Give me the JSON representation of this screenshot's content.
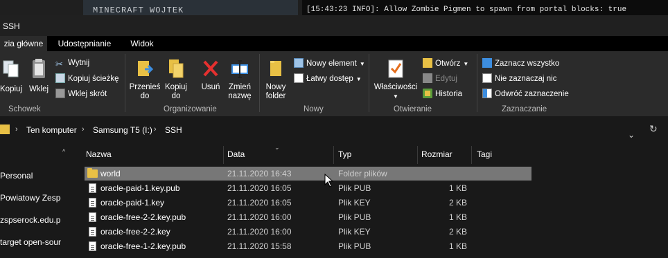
{
  "background": {
    "left_window_title": "MINECRAFT WOJTEK",
    "console_line": "[15:43:23 INFO]: Allow Zombie Pigmen to spawn from portal blocks: true"
  },
  "window": {
    "title": "SSH"
  },
  "ribbon_tabs": [
    {
      "label": "zia główne",
      "active": true
    },
    {
      "label": "Udostępnianie",
      "active": false
    },
    {
      "label": "Widok",
      "active": false
    }
  ],
  "ribbon": {
    "clipboard": {
      "copy": "Kopiuj",
      "paste": "Wklej",
      "cut": "Wytnij",
      "copy_path": "Kopiuj ścieżkę",
      "paste_shortcut": "Wklej skrót",
      "group": "Schowek"
    },
    "organize": {
      "move_to_1": "Przenieś",
      "move_to_2": "do",
      "copy_to_1": "Kopiuj",
      "copy_to_2": "do",
      "delete": "Usuń",
      "rename_1": "Zmień",
      "rename_2": "nazwę",
      "group": "Organizowanie"
    },
    "new": {
      "new_folder_1": "Nowy",
      "new_folder_2": "folder",
      "new_item": "Nowy element",
      "easy_access": "Łatwy dostęp",
      "group": "Nowy"
    },
    "open": {
      "properties": "Właściwości",
      "open": "Otwórz",
      "edit": "Edytuj",
      "history": "Historia",
      "group": "Otwieranie"
    },
    "select": {
      "select_all": "Zaznacz wszystko",
      "select_none": "Nie zaznaczaj nic",
      "invert": "Odwróć zaznaczenie",
      "group": "Zaznaczanie"
    }
  },
  "address": {
    "crumbs": [
      "Ten komputer",
      "Samsung T5 (I:)",
      "SSH"
    ]
  },
  "nav": {
    "items": [
      "Personal",
      "Powiatowy Zespo",
      "zspserock.edu.p",
      "target open-sour"
    ]
  },
  "columns": [
    "Nazwa",
    "Data",
    "Typ",
    "Rozmiar",
    "Tagi"
  ],
  "files": [
    {
      "name": "world",
      "date": "21.11.2020 16:43",
      "type": "Folder plików",
      "size": "",
      "folder": true,
      "selected": true
    },
    {
      "name": "oracle-paid-1.key.pub",
      "date": "21.11.2020 16:05",
      "type": "Plik PUB",
      "size": "1 KB"
    },
    {
      "name": "oracle-paid-1.key",
      "date": "21.11.2020 16:05",
      "type": "Plik KEY",
      "size": "2 KB"
    },
    {
      "name": "oracle-free-2-2.key.pub",
      "date": "21.11.2020 16:00",
      "type": "Plik PUB",
      "size": "1 KB"
    },
    {
      "name": "oracle-free-2-2.key",
      "date": "21.11.2020 16:00",
      "type": "Plik KEY",
      "size": "2 KB"
    },
    {
      "name": "oracle-free-1-2.key.pub",
      "date": "21.11.2020 15:58",
      "type": "Plik PUB",
      "size": "1 KB"
    }
  ]
}
